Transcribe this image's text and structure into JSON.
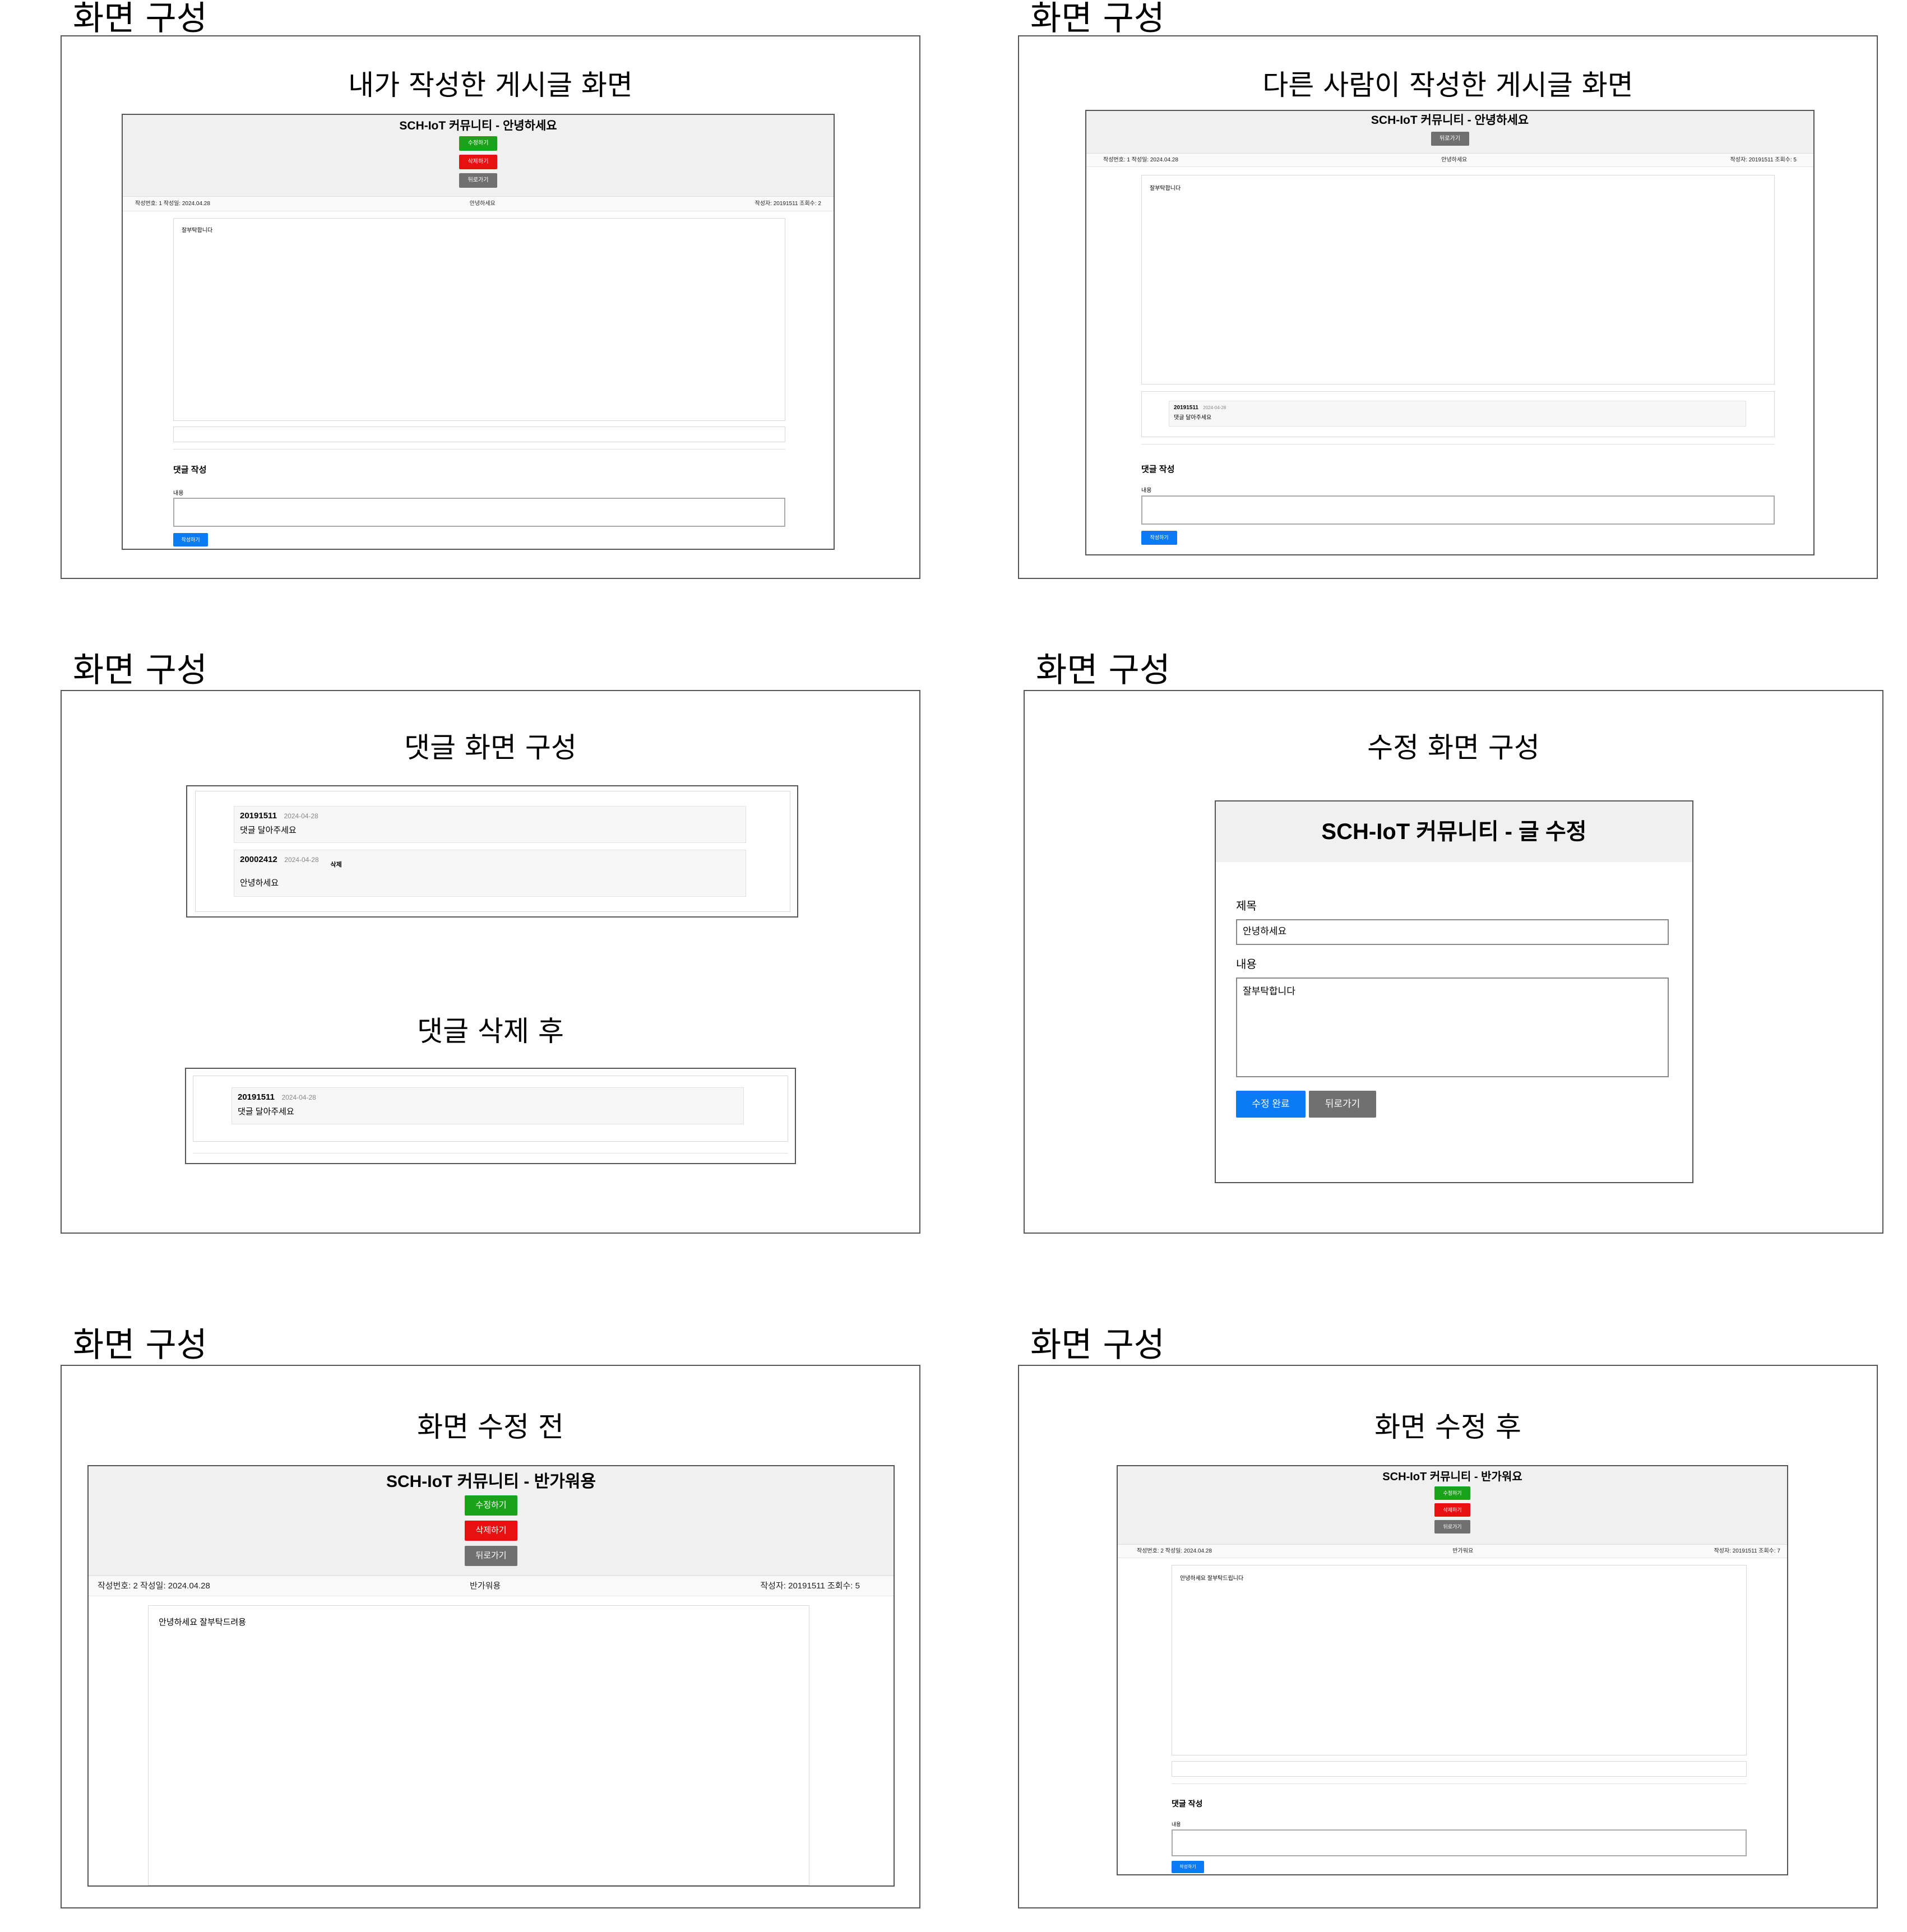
{
  "section_label": "화면 구성",
  "panels": {
    "p1": {
      "caption": "내가 작성한 게시글 화면"
    },
    "p2": {
      "caption": "다른 사람이 작성한 게시글 화면"
    },
    "p3": {
      "caption_a": "댓글 화면 구성",
      "caption_b": "댓글 삭제 후"
    },
    "p4": {
      "caption": "수정 화면 구성"
    },
    "p5": {
      "caption": "화면 수정 전"
    },
    "p6": {
      "caption": "화면 수정 후"
    }
  },
  "post1": {
    "title": "SCH-IoT 커뮤니티 - 안녕하세요",
    "edit": "수정하기",
    "delete": "삭제하기",
    "back": "뒤로가기",
    "info_left": "작성번호: 1 작성일: 2024.04.28",
    "info_mid": "안녕하세요",
    "info_right": "작성자: 20191511 조회수: 2",
    "body": "잘부탁합니다",
    "comment_heading": "댓글 작성",
    "content_label": "내용",
    "submit": "작성하기"
  },
  "post2": {
    "title": "SCH-IoT 커뮤니티 - 안녕하세요",
    "back": "뒤로가기",
    "info_left": "작성번호: 1 작성일: 2024.04.28",
    "info_mid": "안녕하세요",
    "info_right": "작성자: 20191511 조회수: 5",
    "body": "잘부탁합니다",
    "comment_author": "20191511",
    "comment_date": "2024-04-28",
    "comment_text": "댓글 달아주세요",
    "comment_heading": "댓글 작성",
    "content_label": "내용",
    "submit": "작성하기"
  },
  "comments_view": {
    "c1_author": "20191511",
    "c1_date": "2024-04-28",
    "c1_text": "댓글 달아주세요",
    "c2_author": "20002412",
    "c2_date": "2024-04-28",
    "c2_delete": "삭제",
    "c2_text": "안녕하세요"
  },
  "comments_after": {
    "c1_author": "20191511",
    "c1_date": "2024-04-28",
    "c1_text": "댓글 달아주세요"
  },
  "edit_form": {
    "title": "SCH-IoT 커뮤니티 - 글 수정",
    "title_label": "제목",
    "title_value": "안녕하세요",
    "content_label": "내용",
    "content_value": "잘부탁합니다",
    "save": "수정 완료",
    "back": "뒤로가기"
  },
  "post_before": {
    "title": "SCH-IoT 커뮤니티 - 반가워용",
    "edit": "수정하기",
    "delete": "삭제하기",
    "back": "뒤로가기",
    "info_left": "작성번호: 2 작성일: 2024.04.28",
    "info_mid": "반가워용",
    "info_right": "작성자: 20191511 조회수: 5",
    "body": "안녕하세요 잘부탁드려용"
  },
  "post_after": {
    "title": "SCH-IoT 커뮤니티 - 반가워요",
    "edit": "수정하기",
    "delete": "삭제하기",
    "back": "뒤로가기",
    "info_left": "작성번호: 2 작성일: 2024.04.28",
    "info_mid": "반가워요",
    "info_right": "작성자: 20191511 조회수: 7",
    "body": "안녕하세요 잘부탁드립니다",
    "comment_heading": "댓글 작성",
    "content_label": "내용",
    "submit": "작성하기"
  }
}
